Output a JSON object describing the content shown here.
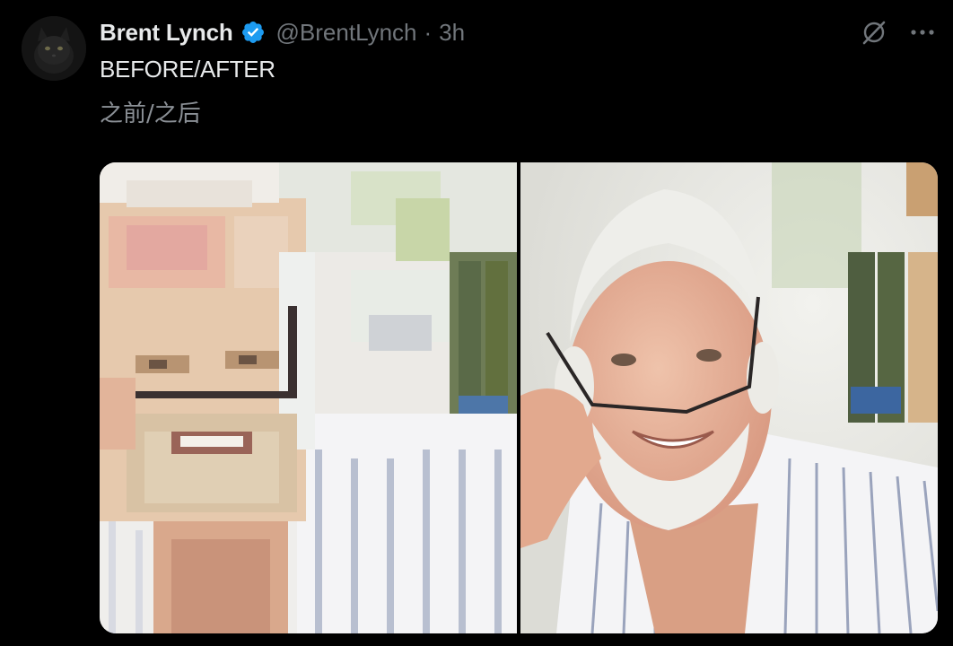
{
  "tweet": {
    "display_name": "Brent Lynch",
    "handle": "@BrentLynch",
    "separator": "·",
    "time": "3h",
    "text": "BEFORE/AFTER",
    "translation": "之前/之后",
    "verified_icon": "verified-badge-icon",
    "colors": {
      "background": "#000000",
      "primary_text": "#e7e9ea",
      "secondary_text": "#71767b",
      "verified_blue": "#1d9bf0"
    }
  },
  "actions": {
    "grok_icon": "grok-icon",
    "more_icon": "more-options-icon"
  },
  "media": {
    "images": [
      {
        "kind": "before-pixelated-photo"
      },
      {
        "kind": "after-photo"
      }
    ]
  }
}
